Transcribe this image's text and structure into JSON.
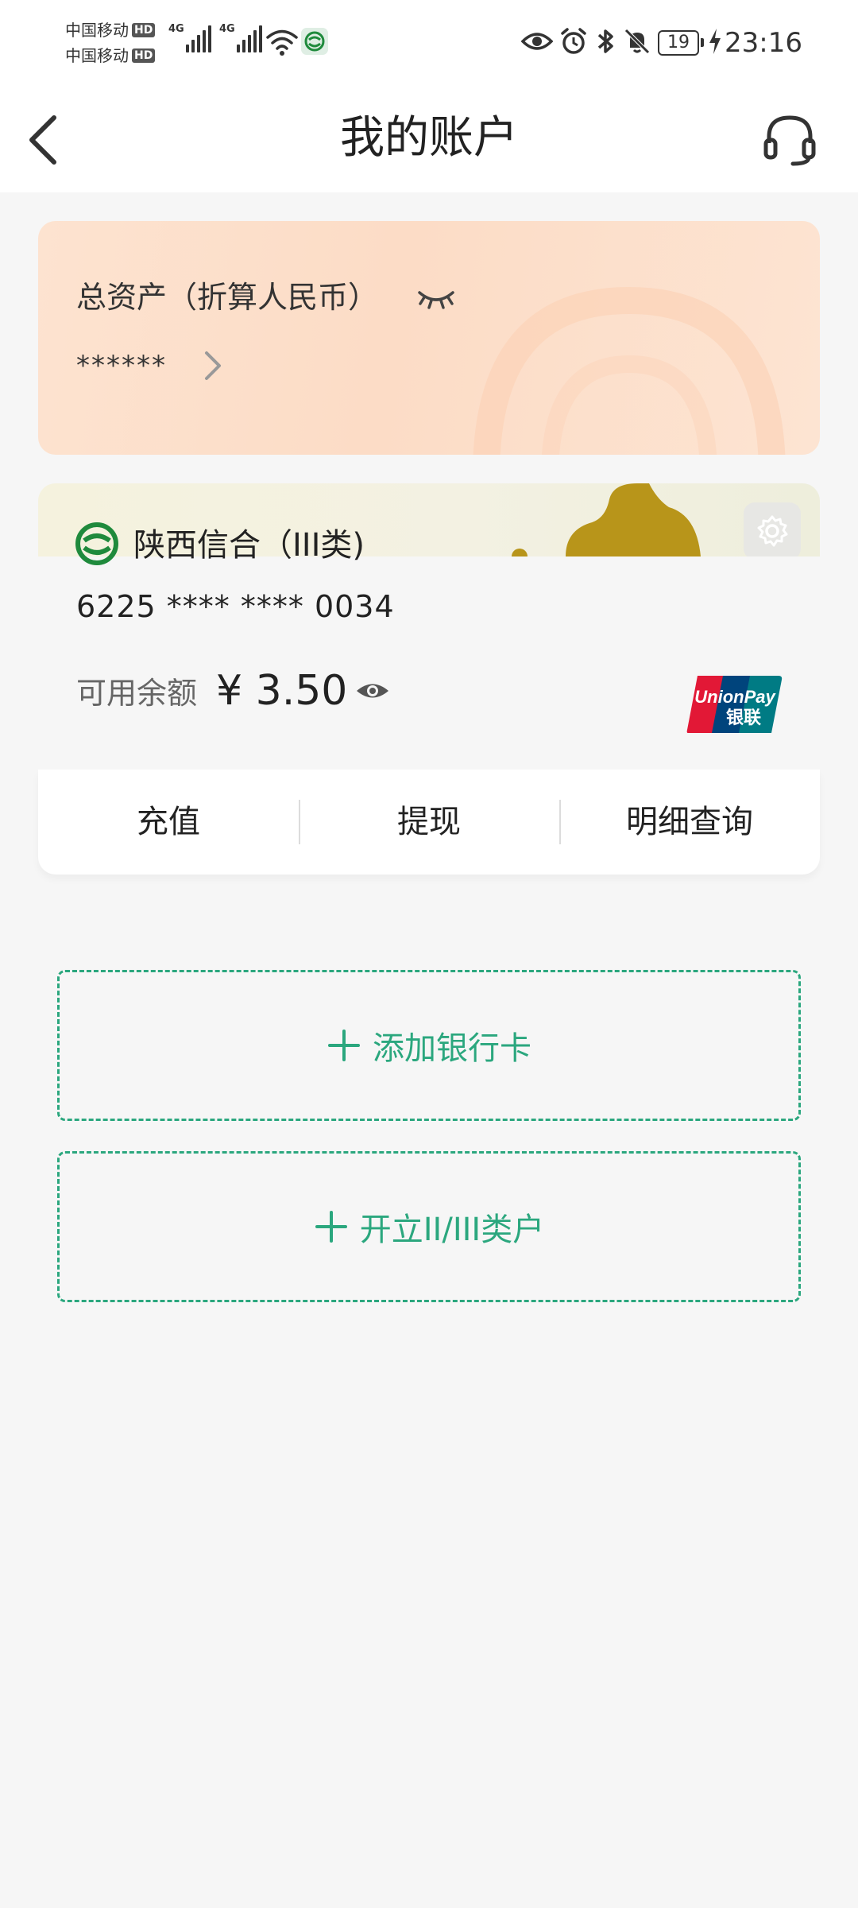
{
  "status_bar": {
    "carrier_1": "中国移动",
    "carrier_2": "中国移动",
    "hd_label": "HD",
    "network_1": "4G",
    "network_2": "4G",
    "battery": "19",
    "time": "23:16"
  },
  "header": {
    "title": "我的账户",
    "back_icon": "chevron-left-icon",
    "service_icon": "headset-icon"
  },
  "asset": {
    "label": "总资产（折算人民币）",
    "value": "******",
    "visibility_icon": "eye-closed-icon",
    "arrow_icon": "chevron-right-icon"
  },
  "card": {
    "bank_name": "陕西信合（III类)",
    "number": "6225 **** **** 0034",
    "balance_label": "可用余额",
    "balance_value": "¥ 3.50",
    "settings_icon": "gear-icon",
    "visibility_icon": "eye-open-icon",
    "network_logo": "unionpay-logo",
    "actions": [
      "充值",
      "提现",
      "明细查询"
    ]
  },
  "add_buttons": {
    "add_card": "添加银行卡",
    "open_account": "开立II/III类户"
  },
  "colors": {
    "accent_green": "#2ba77e",
    "bank_green": "#1f8a3c",
    "asset_card_bg": "#fcdcc6",
    "page_bg": "#f6f6f6"
  }
}
